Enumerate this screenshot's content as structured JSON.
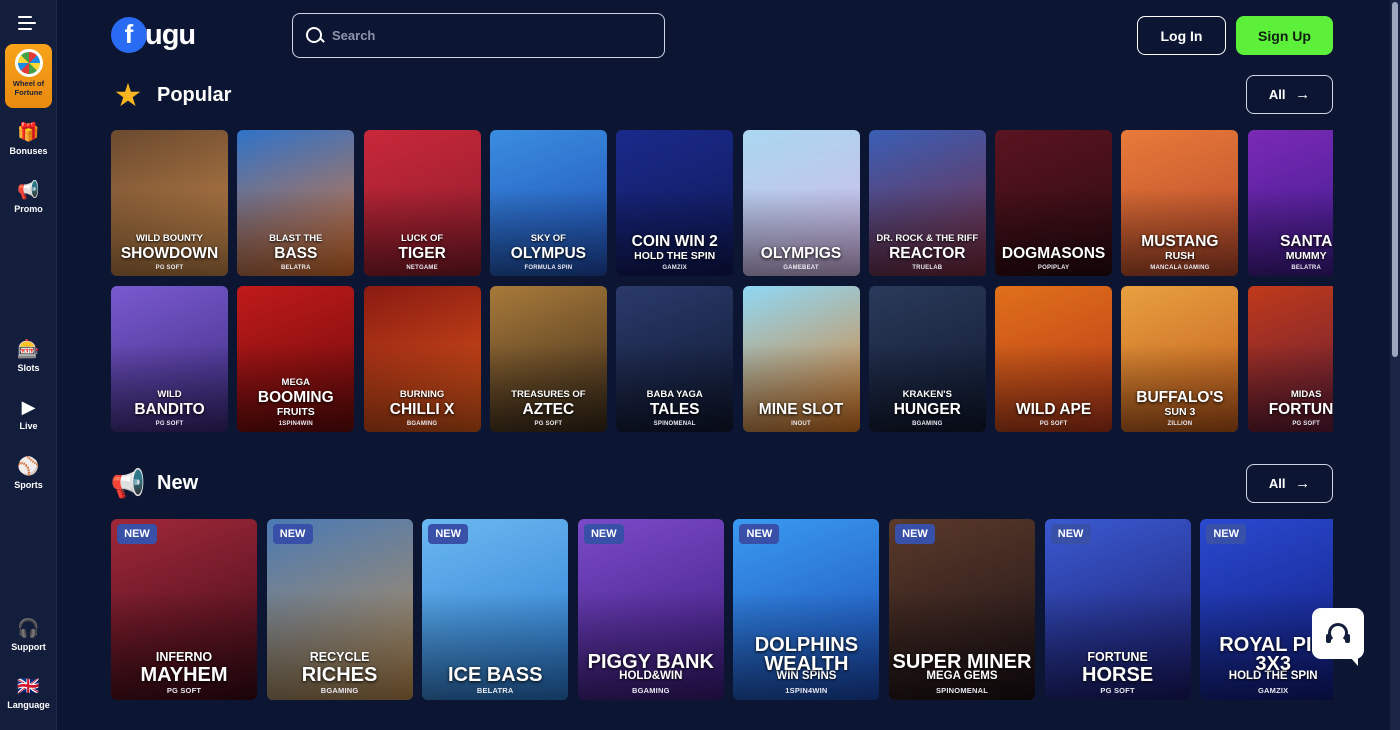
{
  "sidebar": {
    "wheel_of_fortune": {
      "label_line1": "Wheel of",
      "label_line2": "Fortune"
    },
    "items": [
      {
        "label": "Bonuses",
        "icon": "gift-icon",
        "glyph": "🎁"
      },
      {
        "label": "Promo",
        "icon": "megaphone-icon",
        "glyph": "📢"
      },
      {
        "label": "Slots",
        "icon": "slot-machine-icon",
        "glyph": "🎰"
      },
      {
        "label": "Live",
        "icon": "play-icon",
        "glyph": "▶"
      },
      {
        "label": "Sports",
        "icon": "ball-icon",
        "glyph": "⚾"
      },
      {
        "label": "Support",
        "icon": "headset-icon",
        "glyph": "🎧"
      },
      {
        "label": "Language",
        "icon": "uk-flag-icon",
        "glyph": "🇬🇧"
      }
    ]
  },
  "header": {
    "logo_initial": "f",
    "logo_rest": "ugu",
    "search_placeholder": "Search",
    "login_label": "Log In",
    "signup_label": "Sign Up"
  },
  "popular": {
    "title": "Popular",
    "all_label": "All",
    "arrow": "→",
    "row1": [
      {
        "t1": "WILD BOUNTY",
        "t2": "SHOWDOWN",
        "prov": "PG SOFT",
        "bg": [
          "#6b4a2f",
          "#c98a4b"
        ]
      },
      {
        "t1": "BLAST THE",
        "t2": "BASS",
        "prov": "BELATRA",
        "bg": [
          "#2f73c9",
          "#e8742a"
        ]
      },
      {
        "t1": "LUCK OF",
        "t2": "TIGER",
        "prov": "NETGAME",
        "bg": [
          "#c8283a",
          "#8a1c2b"
        ]
      },
      {
        "t1": "SKY OF",
        "t2": "OLYMPUS",
        "prov": "FORMULA SPIN",
        "bg": [
          "#3a8de0",
          "#1f4fb5"
        ]
      },
      {
        "t1": "",
        "t2": "COIN WIN 2",
        "t3": "HOLD THE SPIN",
        "prov": "GAMZIX",
        "bg": [
          "#1a2a8a",
          "#0f1857"
        ]
      },
      {
        "t1": "",
        "t2": "OLYMPIGS",
        "prov": "GAMEBEAT",
        "bg": [
          "#a9d7f0",
          "#d7b8ea"
        ]
      },
      {
        "t1": "DR. ROCK & THE RIFF",
        "t2": "REACTOR",
        "prov": "TRUELAB",
        "bg": [
          "#3a5eb5",
          "#7a2a3a"
        ]
      },
      {
        "t1": "",
        "t2": "DOGMASONS",
        "prov": "POPIPLAY",
        "bg": [
          "#5a1420",
          "#2a0a10"
        ]
      },
      {
        "t1": "",
        "t2": "MUSTANG",
        "t3": "RUSH",
        "prov": "MANCALA GAMING",
        "bg": [
          "#e87a3a",
          "#b5482a"
        ]
      },
      {
        "t1": "",
        "t2": "SANTA",
        "t3": "MUMMY",
        "prov": "BELATRA",
        "bg": [
          "#7a2ab5",
          "#3a1a8a"
        ]
      }
    ],
    "row2": [
      {
        "t1": "WILD",
        "t2": "BANDITO",
        "prov": "PG SOFT",
        "bg": [
          "#7a5ad0",
          "#3a2a7a"
        ]
      },
      {
        "t1": "MEGA",
        "t2": "BOOMING",
        "t3": "FRUITS",
        "prov": "1SPIN4WIN",
        "bg": [
          "#c01a1a",
          "#6a0a0a"
        ]
      },
      {
        "t1": "BURNING",
        "t2": "CHILLI X",
        "prov": "BGAMING",
        "bg": [
          "#8a1a12",
          "#e05a1a"
        ]
      },
      {
        "t1": "TREASURES OF",
        "t2": "AZTEC",
        "prov": "PG SOFT",
        "bg": [
          "#a87a3a",
          "#3a2a1a"
        ]
      },
      {
        "t1": "BABA YAGA",
        "t2": "TALES",
        "prov": "SPINOMENAL",
        "bg": [
          "#2a3a6a",
          "#0f1830"
        ]
      },
      {
        "t1": "",
        "t2": "MINE SLOT",
        "prov": "INOUT",
        "bg": [
          "#8fd8f5",
          "#e07a20"
        ]
      },
      {
        "t1": "KRAKEN'S",
        "t2": "HUNGER",
        "prov": "BGAMING",
        "bg": [
          "#2a3a5a",
          "#0f182f"
        ]
      },
      {
        "t1": "",
        "t2": "WILD APE",
        "prov": "PG SOFT",
        "bg": [
          "#e0701a",
          "#b5381a"
        ]
      },
      {
        "t1": "",
        "t2": "BUFFALO'S",
        "t3": "SUN 3",
        "prov": "ZILLION",
        "bg": [
          "#e8a040",
          "#c05a1a"
        ]
      },
      {
        "t1": "MIDAS",
        "t2": "FORTUNE",
        "prov": "PG SOFT",
        "bg": [
          "#c03a1a",
          "#5a1a3a"
        ]
      }
    ]
  },
  "new": {
    "title": "New",
    "all_label": "All",
    "arrow": "→",
    "badge": "NEW",
    "cards": [
      {
        "t1": "INFERNO",
        "t2": "MAYHEM",
        "prov": "PG SOFT",
        "bg": [
          "#a0283a",
          "#3a0a14"
        ]
      },
      {
        "t1": "RECYCLE",
        "t2": "RICHES",
        "prov": "BGAMING",
        "bg": [
          "#4a7ab5",
          "#c09050"
        ]
      },
      {
        "t1": "",
        "t2": "ICE BASS",
        "prov": "BELATRA",
        "bg": [
          "#6ab8f0",
          "#2a7ad0"
        ]
      },
      {
        "t1": "",
        "t2": "PIGGY BANK",
        "t3": "HOLD&WIN",
        "prov": "BGAMING",
        "bg": [
          "#7a4ac8",
          "#3a1a7a"
        ]
      },
      {
        "t1": "",
        "t2": "DOLPHINS",
        "t3x": "WEALTH",
        "t3": "WIN SPINS",
        "prov": "1SPIN4WIN",
        "bg": [
          "#3a9af0",
          "#1a4ab5"
        ]
      },
      {
        "t1": "",
        "t2": "SUPER MINER",
        "t3": "MEGA GEMS",
        "prov": "SPINOMENAL",
        "bg": [
          "#5a3a2a",
          "#1a1015"
        ]
      },
      {
        "t1": "FORTUNE",
        "t2": "HORSE",
        "prov": "PG SOFT",
        "bg": [
          "#3a5ad0",
          "#1a1a6a"
        ]
      },
      {
        "t1": "",
        "t2": "ROYAL PIG",
        "t3x": "3X3",
        "t3": "HOLD THE SPIN",
        "prov": "GAMZIX",
        "bg": [
          "#2a4ad0",
          "#0f1a7a"
        ]
      }
    ]
  }
}
